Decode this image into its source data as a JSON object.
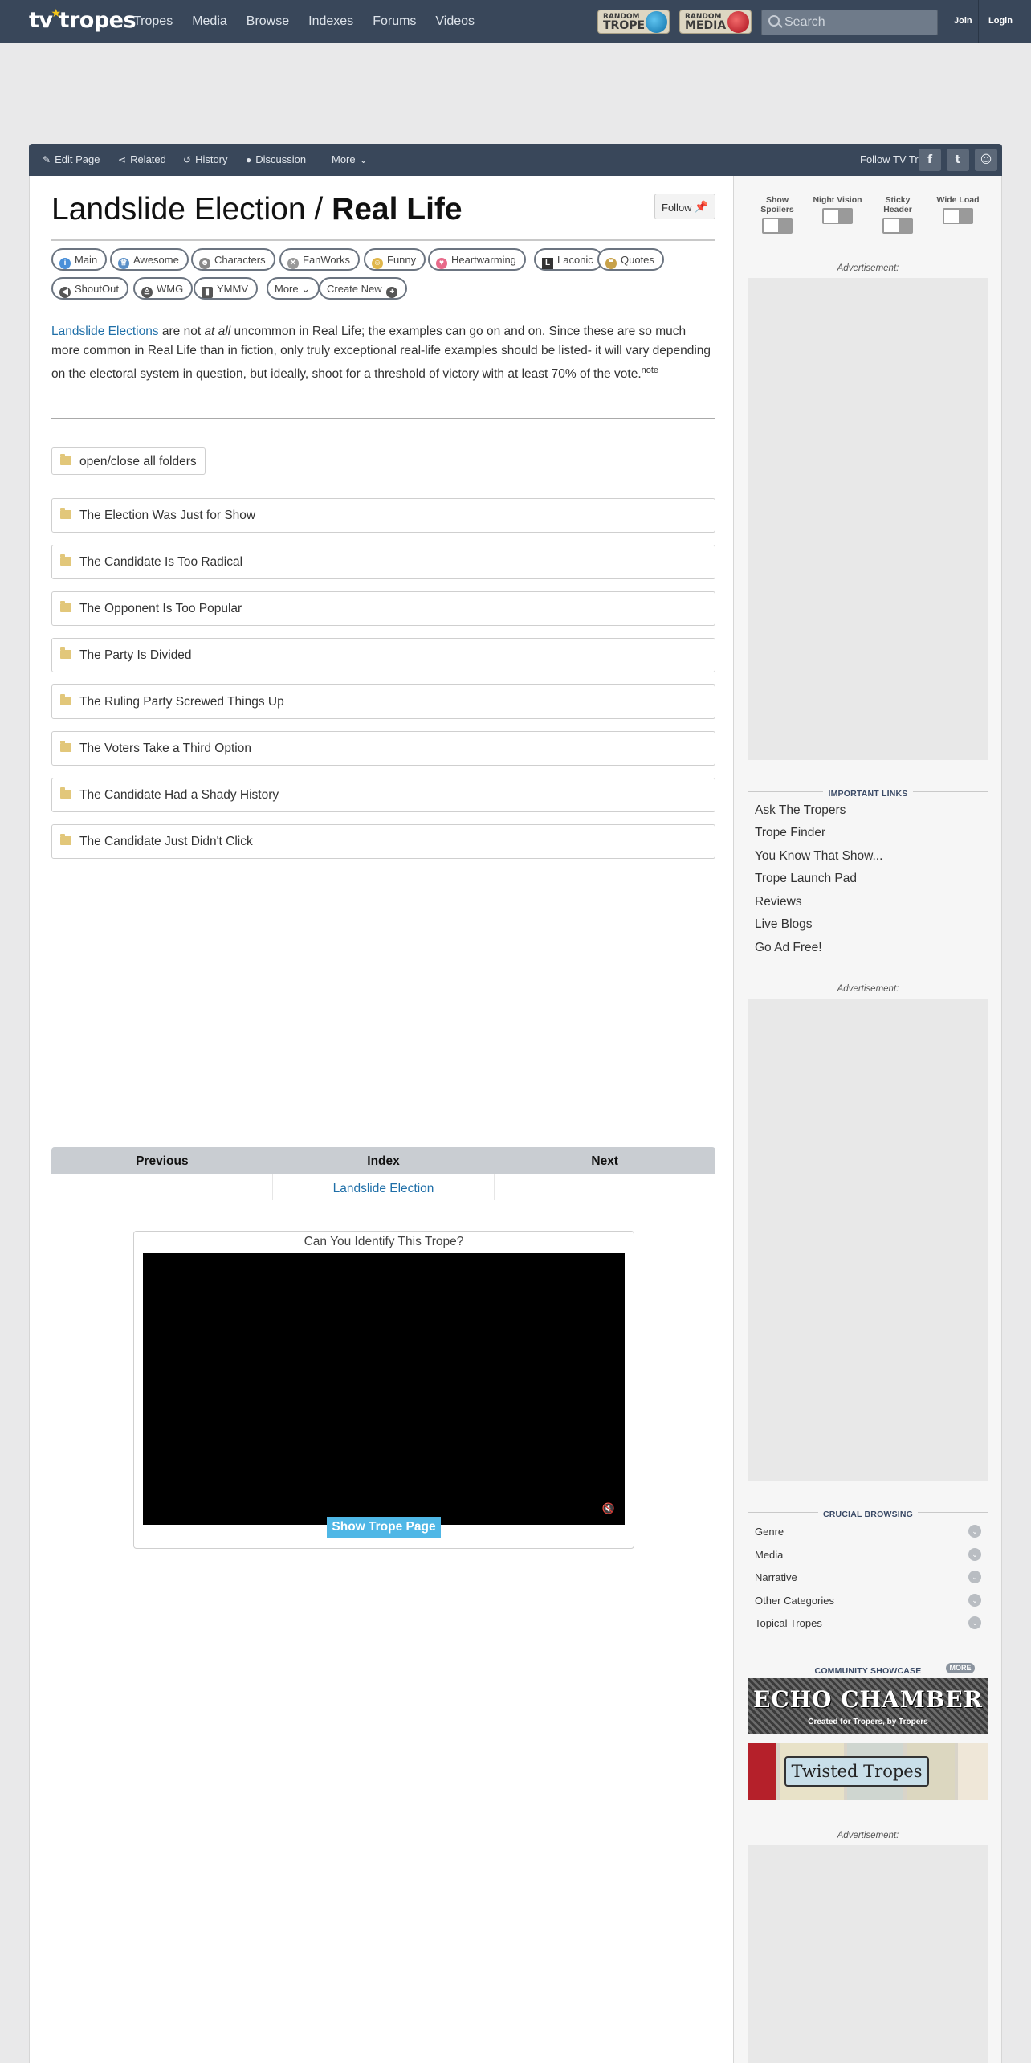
{
  "topnav": {
    "logo_pre": "tv",
    "logo_post": "tropes",
    "links": [
      "Tropes",
      "Media",
      "Browse",
      "Indexes",
      "Forums",
      "Videos"
    ],
    "random_trope": {
      "line1": "RANDOM",
      "line2": "TROPE"
    },
    "random_media": {
      "line1": "RANDOM",
      "line2": "MEDIA"
    },
    "search_placeholder": "Search",
    "join": "Join",
    "login": "Login"
  },
  "actions": {
    "edit": "Edit Page",
    "related": "Related",
    "history": "History",
    "discussion": "Discussion",
    "more": "More",
    "follow_tvt": "Follow TV Tropes"
  },
  "page": {
    "title_pre": "Landslide Election / ",
    "title_bold": "Real Life",
    "follow": "Follow",
    "pills": [
      "Main",
      "Awesome",
      "Characters",
      "FanWorks",
      "Funny",
      "Heartwarming",
      "Laconic",
      "Quotes",
      "ShoutOut",
      "WMG",
      "YMMV",
      "More",
      "Create New"
    ],
    "desc": {
      "link": "Landslide Elections",
      "t1": " are not ",
      "em": "at all",
      "t2": " uncommon in Real Life; the examples can go on and on. Since these are so much more common in Real Life than in fiction, only truly exceptional real-life examples should be listed- it will vary depending on the electoral system in question, but ideally, shoot for a threshold of victory with at least 70% of the vote.",
      "note": "note"
    },
    "open_all": "open/close all folders",
    "folders": [
      "The Election Was Just for Show",
      "The Candidate Is Too Radical",
      "The Opponent Is Too Popular",
      "The Party Is Divided",
      "The Ruling Party Screwed Things Up",
      "The Voters Take a Third Option",
      "The Candidate Had a Shady History",
      "The Candidate Just Didn't Click"
    ],
    "pager": {
      "prev": "Previous",
      "index": "Index",
      "next": "Next",
      "index_link": "Landslide Election"
    },
    "quiz": {
      "title": "Can You Identify This Trope?",
      "button": "Show Trope Page"
    }
  },
  "sidebar": {
    "toggles": [
      "Show Spoilers",
      "Night Vision",
      "Sticky Header",
      "Wide Load"
    ],
    "ad_label": "Advertisement:",
    "important_header": "IMPORTANT LINKS",
    "important": [
      "Ask The Tropers",
      "Trope Finder",
      "You Know That Show...",
      "Trope Launch Pad",
      "Reviews",
      "Live Blogs",
      "Go Ad Free!"
    ],
    "crucial_header": "CRUCIAL BROWSING",
    "crucial": [
      "Genre",
      "Media",
      "Narrative",
      "Other Categories",
      "Topical Tropes"
    ],
    "showcase_header": "COMMUNITY SHOWCASE",
    "more_badge": "MORE",
    "echo_title": "ECHO CHAMBER",
    "echo_sub": "Created for Tropers, by Tropers",
    "twisted": "Twisted Tropes"
  },
  "colors": {
    "nav": "#39475a",
    "link": "#1f6fa8",
    "button": "#4fb7e6",
    "star": "#f5c518"
  }
}
